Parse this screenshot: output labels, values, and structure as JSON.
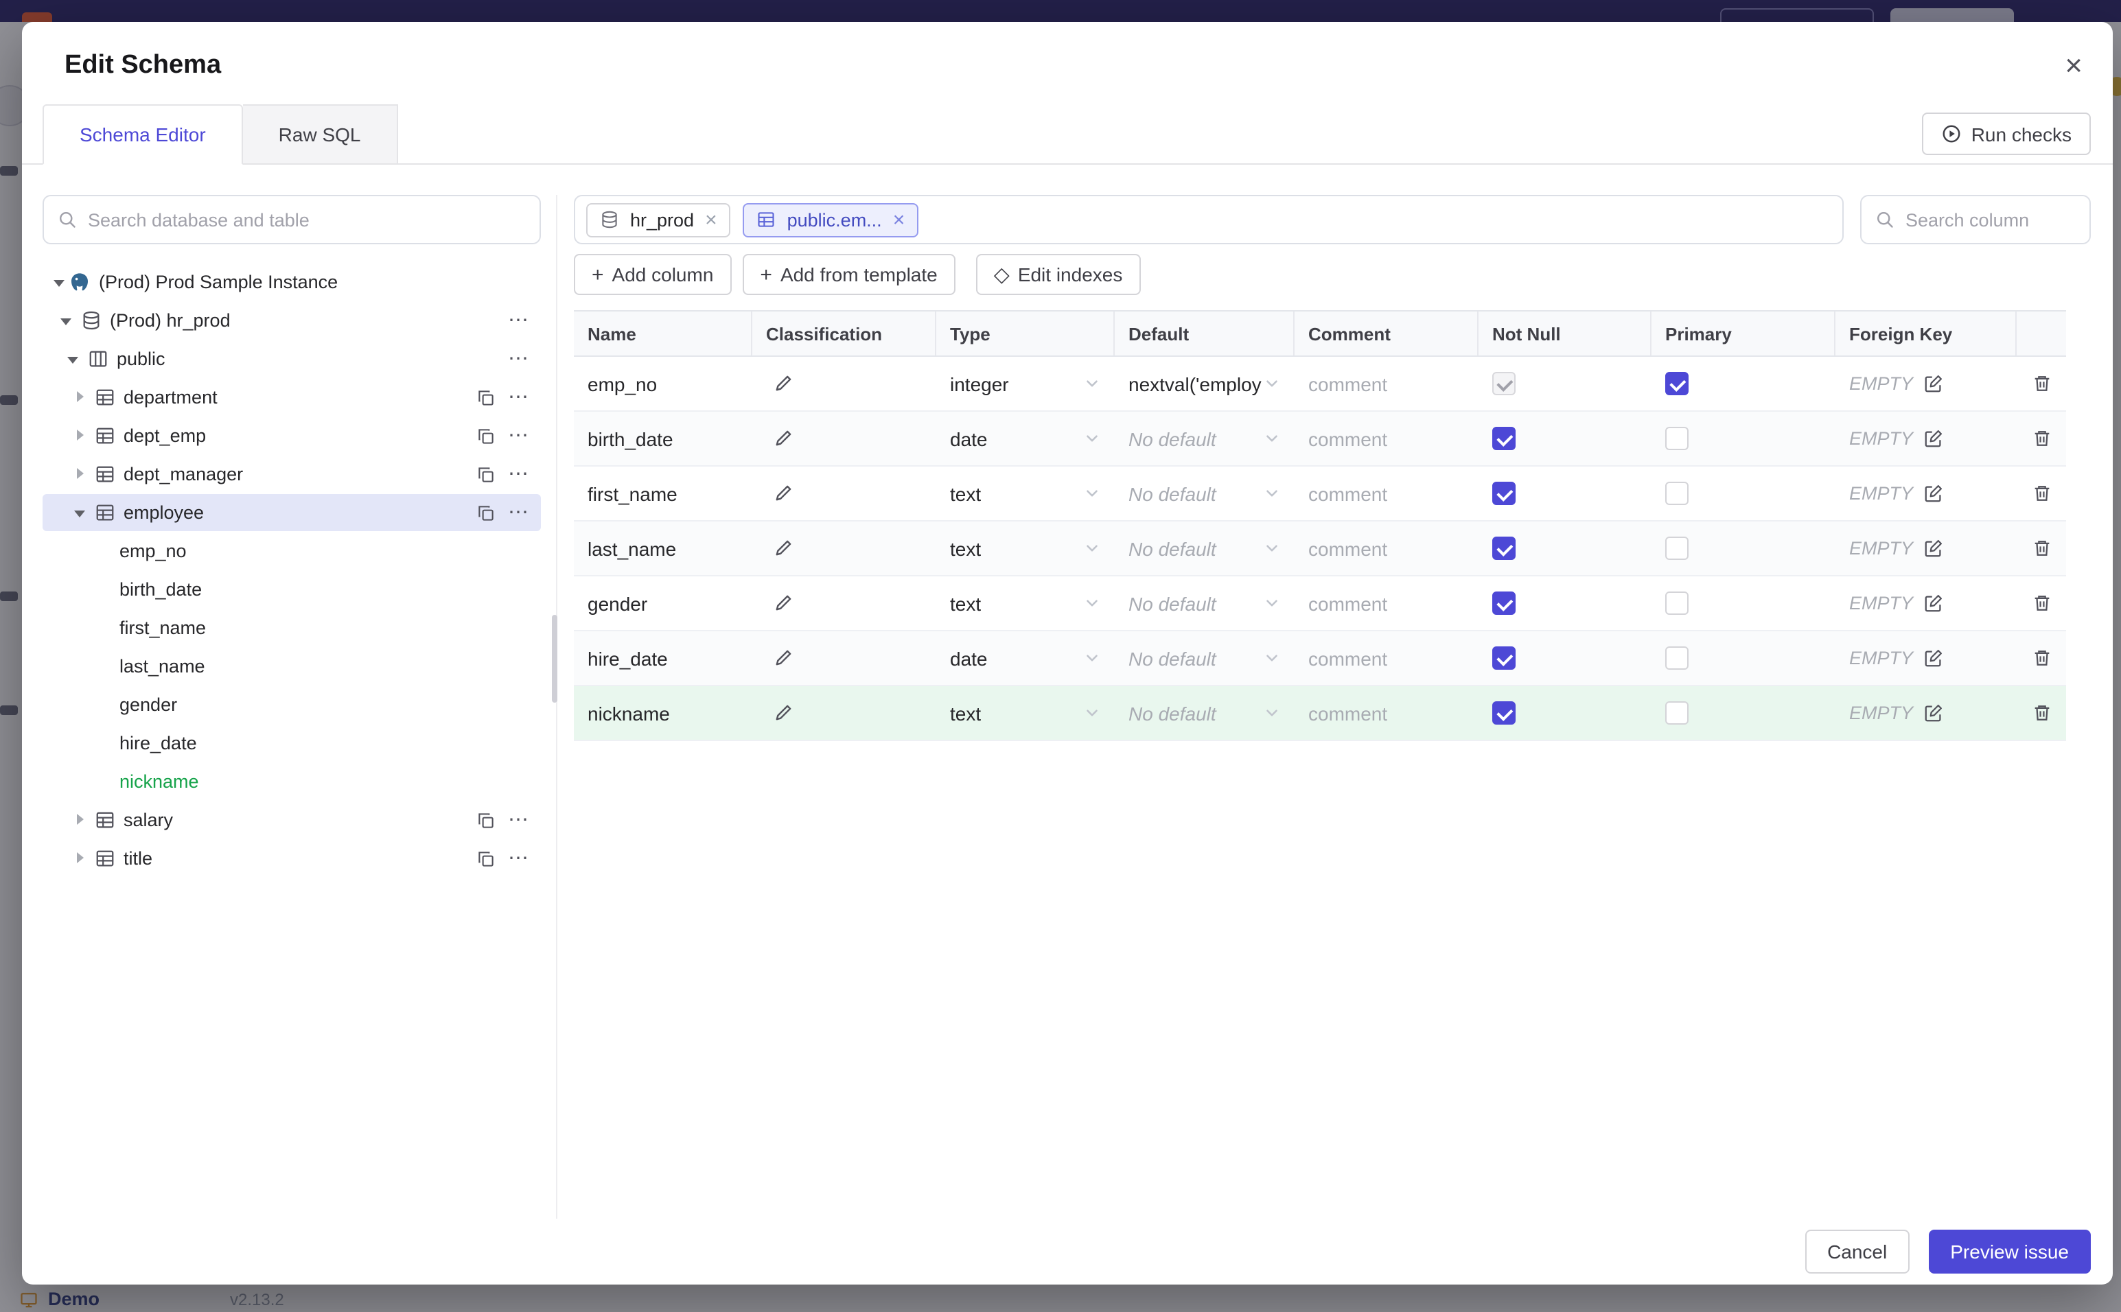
{
  "icons": {
    "kebab": "⋯",
    "close": "×",
    "plus": "+",
    "diamond": "◇"
  },
  "colors": {
    "accent": "#4d48d6",
    "topbar": "#373272",
    "new_green": "#16a34a",
    "selected_bg": "#e3e6f8",
    "chip_selected_bg": "#edeffd"
  },
  "backdrop": {
    "demo_label": "Demo",
    "version": "v2.13.2"
  },
  "modal": {
    "title": "Edit Schema",
    "tabs": [
      {
        "label": "Schema Editor",
        "active": true
      },
      {
        "label": "Raw SQL",
        "active": false
      }
    ],
    "run_checks_label": "Run checks",
    "cancel_label": "Cancel",
    "preview_label": "Preview issue"
  },
  "sidebar": {
    "search_placeholder": "Search database and table",
    "tree": [
      {
        "label": "(Prod) Prod Sample Instance",
        "icon": "postgres",
        "level": 0,
        "expanded": true,
        "selected": false
      },
      {
        "label": "(Prod) hr_prod",
        "icon": "database",
        "level": 1,
        "expanded": true,
        "selected": false
      },
      {
        "label": "public",
        "icon": "schema",
        "level": 2,
        "expanded": true,
        "selected": false
      },
      {
        "label": "department",
        "icon": "table",
        "level": 3,
        "expanded": false,
        "selected": false
      },
      {
        "label": "dept_emp",
        "icon": "table",
        "level": 3,
        "expanded": false,
        "selected": false
      },
      {
        "label": "dept_manager",
        "icon": "table",
        "level": 3,
        "expanded": false,
        "selected": false
      },
      {
        "label": "employee",
        "icon": "table",
        "level": 3,
        "expanded": true,
        "selected": true
      },
      {
        "label": "emp_no",
        "level": 4,
        "new": false
      },
      {
        "label": "birth_date",
        "level": 4,
        "new": false
      },
      {
        "label": "first_name",
        "level": 4,
        "new": false
      },
      {
        "label": "last_name",
        "level": 4,
        "new": false
      },
      {
        "label": "gender",
        "level": 4,
        "new": false
      },
      {
        "label": "hire_date",
        "level": 4,
        "new": false
      },
      {
        "label": "nickname",
        "level": 4,
        "new": true
      },
      {
        "label": "salary",
        "icon": "table",
        "level": 3,
        "expanded": false,
        "selected": false
      },
      {
        "label": "title",
        "icon": "table",
        "level": 3,
        "expanded": false,
        "selected": false
      }
    ]
  },
  "editor": {
    "chips": [
      {
        "label": "hr_prod",
        "icon": "database",
        "selected": false
      },
      {
        "label": "public.em...",
        "icon": "table",
        "selected": true
      }
    ],
    "column_search_placeholder": "Search column",
    "toolbar": {
      "add_column": "Add column",
      "add_from_template": "Add from template",
      "edit_indexes": "Edit indexes"
    },
    "table": {
      "headers": [
        "Name",
        "Classification",
        "Type",
        "Default",
        "Comment",
        "Not Null",
        "Primary",
        "Foreign Key"
      ],
      "comment_placeholder": "comment",
      "foreign_key_empty": "EMPTY",
      "rows": [
        {
          "name": "emp_no",
          "type": "integer",
          "default": "nextval('employ",
          "comment": "",
          "not_null": true,
          "not_null_disabled": true,
          "primary": true,
          "foreign_key": "EMPTY",
          "new": false
        },
        {
          "name": "birth_date",
          "type": "date",
          "default": "No default",
          "comment": "",
          "not_null": true,
          "not_null_disabled": false,
          "primary": false,
          "foreign_key": "EMPTY",
          "new": false
        },
        {
          "name": "first_name",
          "type": "text",
          "default": "No default",
          "comment": "",
          "not_null": true,
          "not_null_disabled": false,
          "primary": false,
          "foreign_key": "EMPTY",
          "new": false
        },
        {
          "name": "last_name",
          "type": "text",
          "default": "No default",
          "comment": "",
          "not_null": true,
          "not_null_disabled": false,
          "primary": false,
          "foreign_key": "EMPTY",
          "new": false
        },
        {
          "name": "gender",
          "type": "text",
          "default": "No default",
          "comment": "",
          "not_null": true,
          "not_null_disabled": false,
          "primary": false,
          "foreign_key": "EMPTY",
          "new": false
        },
        {
          "name": "hire_date",
          "type": "date",
          "default": "No default",
          "comment": "",
          "not_null": true,
          "not_null_disabled": false,
          "primary": false,
          "foreign_key": "EMPTY",
          "new": false
        },
        {
          "name": "nickname",
          "type": "text",
          "default": "No default",
          "comment": "",
          "not_null": true,
          "not_null_disabled": false,
          "primary": false,
          "foreign_key": "EMPTY",
          "new": true
        }
      ]
    }
  }
}
